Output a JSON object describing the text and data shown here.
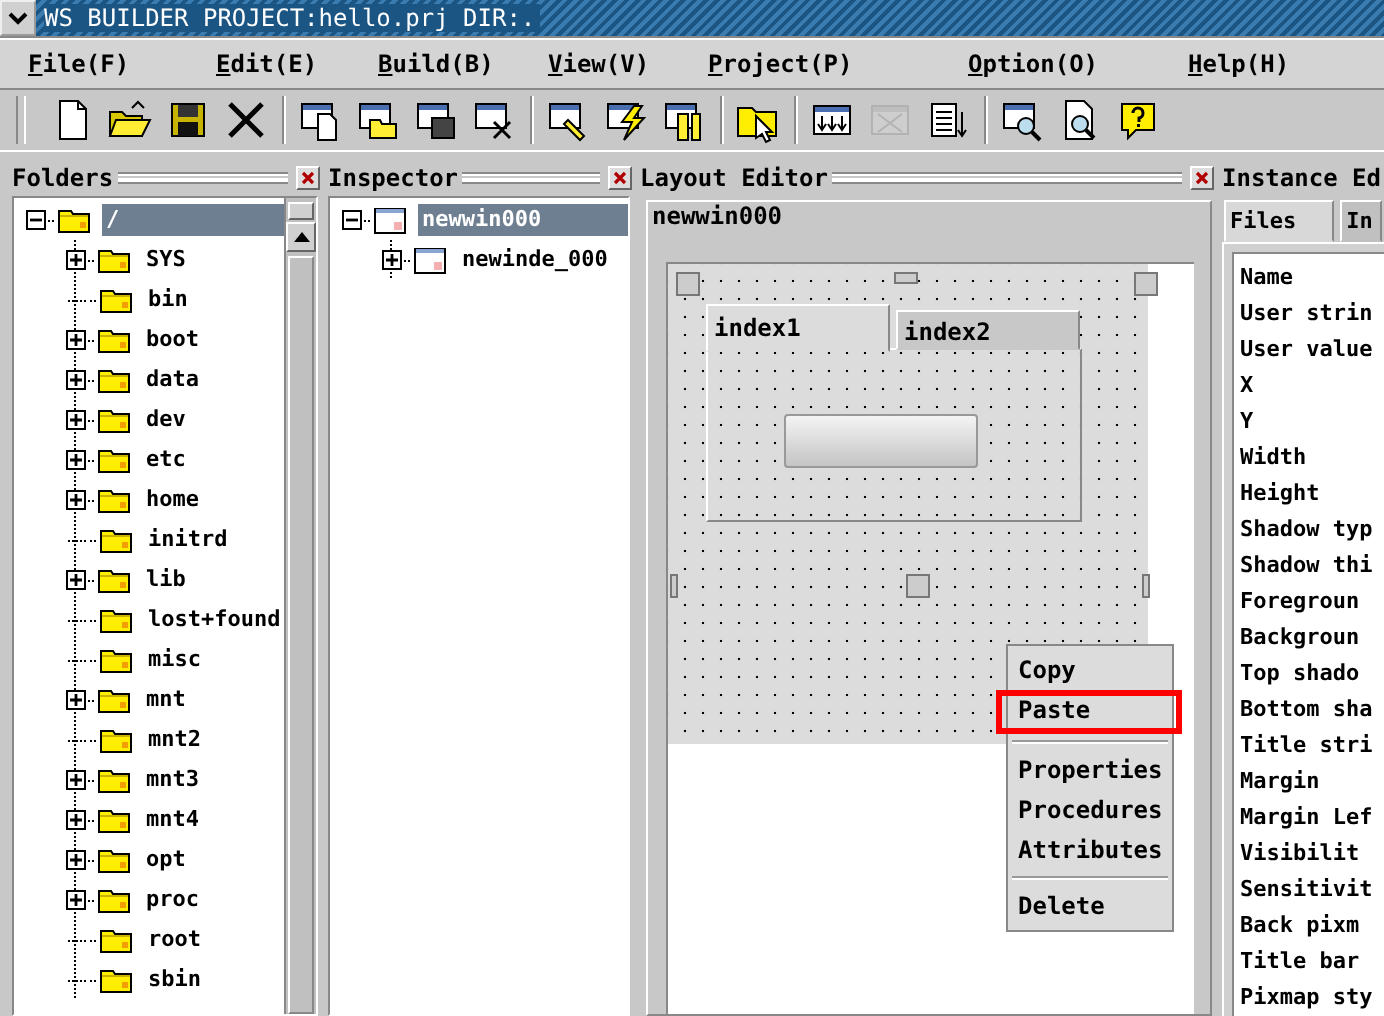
{
  "window": {
    "title": "WS BUILDER PROJECT:hello.prj DIR:."
  },
  "menu": [
    {
      "label": "File(F)"
    },
    {
      "label": "Edit(E)"
    },
    {
      "label": "Build(B)"
    },
    {
      "label": "View(V)"
    },
    {
      "label": "Project(P)"
    },
    {
      "label": "Option(O)"
    },
    {
      "label": "Help(H)"
    }
  ],
  "toolbar": [
    {
      "kind": "new",
      "disabled": false
    },
    {
      "kind": "open",
      "disabled": false
    },
    {
      "kind": "save",
      "disabled": false
    },
    {
      "kind": "cut",
      "disabled": false
    },
    {
      "kind": "separator"
    },
    {
      "kind": "win-new",
      "disabled": false
    },
    {
      "kind": "win-open",
      "disabled": false
    },
    {
      "kind": "win-save",
      "disabled": false
    },
    {
      "kind": "win-close",
      "disabled": false
    },
    {
      "kind": "separator"
    },
    {
      "kind": "win-edit",
      "disabled": false
    },
    {
      "kind": "win-build",
      "disabled": false
    },
    {
      "kind": "win-tools",
      "disabled": false
    },
    {
      "kind": "separator"
    },
    {
      "kind": "folder-pointer",
      "disabled": false
    },
    {
      "kind": "separator"
    },
    {
      "kind": "grid-down",
      "disabled": false
    },
    {
      "kind": "grid-x",
      "disabled": true
    },
    {
      "kind": "list-sort",
      "disabled": false
    },
    {
      "kind": "separator"
    },
    {
      "kind": "win-search",
      "disabled": false
    },
    {
      "kind": "doc-search",
      "disabled": false
    },
    {
      "kind": "help",
      "disabled": false
    }
  ],
  "folders": {
    "title": "Folders",
    "close_button": true,
    "items": [
      {
        "label": "/",
        "selected": true,
        "expandable": true,
        "expanded": true,
        "children": [
          {
            "label": "SYS",
            "selected": false,
            "expandable": true,
            "expanded": false
          },
          {
            "label": "bin",
            "selected": false,
            "expandable": false
          },
          {
            "label": "boot",
            "selected": false,
            "expandable": true,
            "expanded": false
          },
          {
            "label": "data",
            "selected": false,
            "expandable": true,
            "expanded": false
          },
          {
            "label": "dev",
            "selected": false,
            "expandable": true,
            "expanded": false
          },
          {
            "label": "etc",
            "selected": false,
            "expandable": true,
            "expanded": false
          },
          {
            "label": "home",
            "selected": false,
            "expandable": true,
            "expanded": false
          },
          {
            "label": "initrd",
            "selected": false,
            "expandable": false
          },
          {
            "label": "lib",
            "selected": false,
            "expandable": true,
            "expanded": false
          },
          {
            "label": "lost+found",
            "selected": false,
            "expandable": false
          },
          {
            "label": "misc",
            "selected": false,
            "expandable": false
          },
          {
            "label": "mnt",
            "selected": false,
            "expandable": true,
            "expanded": false
          },
          {
            "label": "mnt2",
            "selected": false,
            "expandable": false
          },
          {
            "label": "mnt3",
            "selected": false,
            "expandable": true,
            "expanded": false
          },
          {
            "label": "mnt4",
            "selected": false,
            "expandable": true,
            "expanded": false
          },
          {
            "label": "opt",
            "selected": false,
            "expandable": true,
            "expanded": false
          },
          {
            "label": "proc",
            "selected": false,
            "expandable": true,
            "expanded": false
          },
          {
            "label": "root",
            "selected": false,
            "expandable": false
          },
          {
            "label": "sbin",
            "selected": false,
            "expandable": false
          }
        ]
      }
    ]
  },
  "inspector": {
    "title": "Inspector",
    "close_button": true,
    "items": [
      {
        "label": "newwin000",
        "selected": true,
        "expandable": true,
        "expanded": true,
        "children": [
          {
            "label": "newinde_000",
            "selected": false,
            "expandable": true,
            "expanded": false
          }
        ]
      }
    ]
  },
  "layout_editor": {
    "title": "Layout Editor",
    "close_button": true,
    "window_name": "newwin000",
    "tabs": [
      {
        "label": "index1",
        "selected": true
      },
      {
        "label": "index2",
        "selected": false
      }
    ],
    "context_menu": [
      {
        "kind": "item",
        "label": "Copy",
        "highlighted": false
      },
      {
        "kind": "item",
        "label": "Paste",
        "highlighted": true
      },
      {
        "kind": "separator"
      },
      {
        "kind": "item",
        "label": "Properties",
        "highlighted": false
      },
      {
        "kind": "item",
        "label": "Procedures",
        "highlighted": false
      },
      {
        "kind": "item",
        "label": "Attributes",
        "highlighted": false
      },
      {
        "kind": "separator"
      },
      {
        "kind": "item",
        "label": "Delete",
        "highlighted": false
      }
    ]
  },
  "instance_editor": {
    "title": "Instance Ed",
    "tabs": [
      {
        "label": "Files",
        "selected": true
      },
      {
        "label": "In",
        "selected": false
      }
    ],
    "properties": [
      "Name",
      "User strin",
      "User value",
      "X",
      "Y",
      "Width",
      "Height",
      "Shadow typ",
      "Shadow thi",
      "Foregroun",
      "Backgroun",
      "Top shado",
      "Bottom sha",
      "Title stri",
      "Margin",
      "Margin Lef",
      "Visibilit",
      "Sensitivit",
      "Back pixm",
      "Title bar",
      "Pixmap sty"
    ]
  }
}
